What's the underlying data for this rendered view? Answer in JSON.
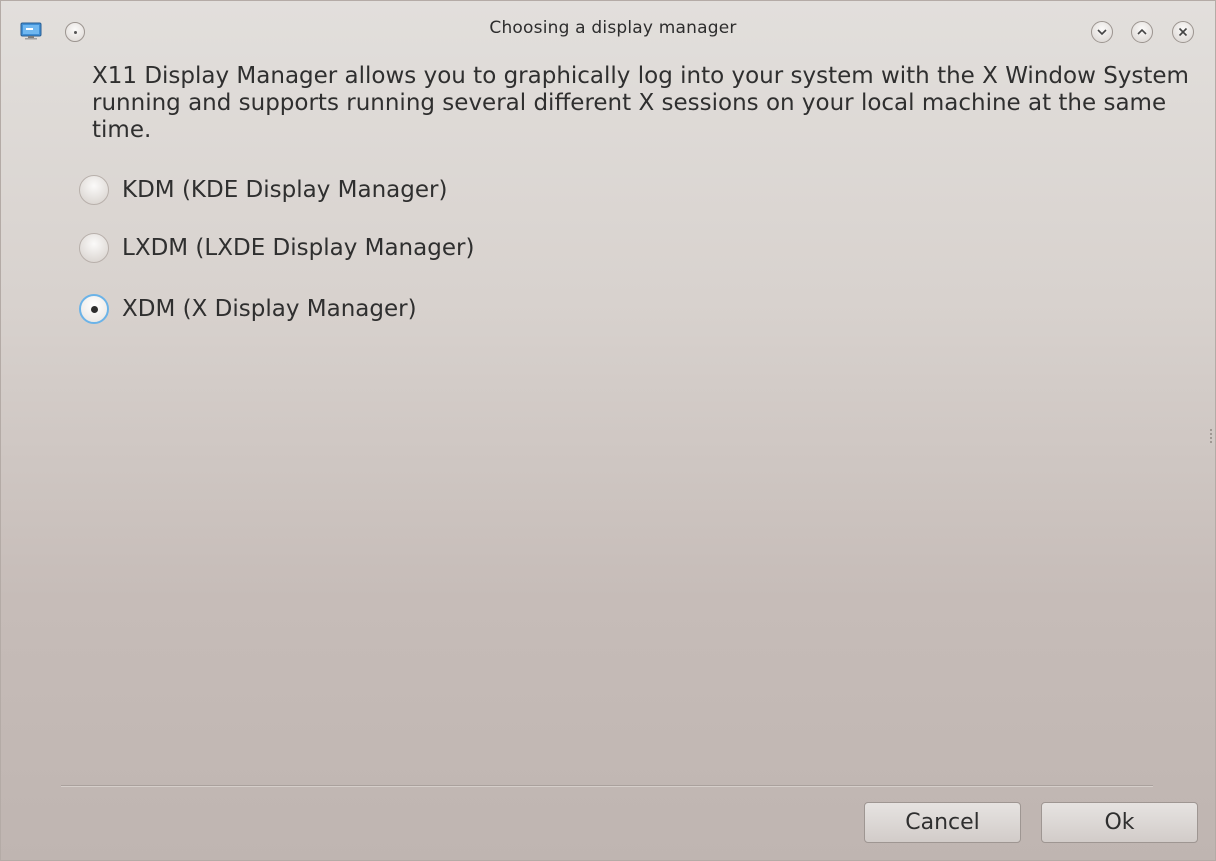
{
  "window": {
    "title": "Choosing a display manager"
  },
  "icons": {
    "app": "monitor-icon",
    "menu": "window-menu-icon",
    "minimize": "minimize-icon",
    "maximize": "maximize-icon",
    "close": "close-icon"
  },
  "content": {
    "description": "X11 Display Manager allows you to graphically log into your system with the X Window System running and supports running several different X sessions on your local machine at the same time.",
    "options": [
      {
        "label": "KDM (KDE Display Manager)",
        "checked": false
      },
      {
        "label": "LXDM (LXDE Display Manager)",
        "checked": false
      },
      {
        "label": "XDM (X Display Manager)",
        "checked": true
      }
    ]
  },
  "buttons": {
    "cancel": "Cancel",
    "ok": "Ok"
  },
  "colors": {
    "accent": "#6bb3e8",
    "background_top": "#e2dfdc",
    "background_bottom": "#bfb5b1",
    "text": "#2f2f2f"
  }
}
